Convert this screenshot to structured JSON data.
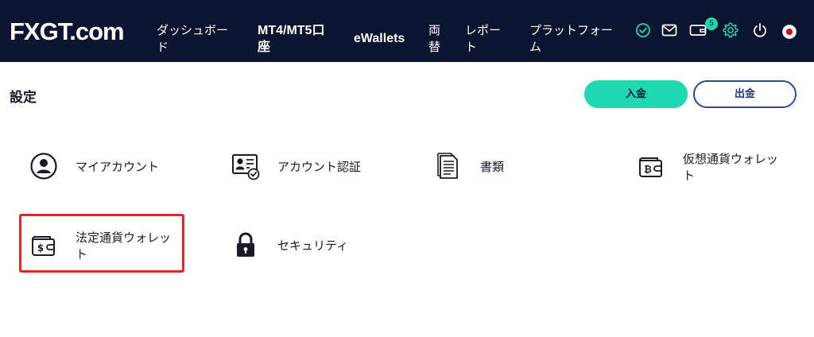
{
  "brand": {
    "logo_text": "FXGT.com"
  },
  "nav": {
    "dashboard": "ダッシュボード",
    "accounts": "MT4/MT5口座",
    "ewallets": "eWallets",
    "exchange": "両替",
    "reports": "レポート",
    "platforms": "プラットフォーム"
  },
  "top_icons": [
    "verified-check-icon",
    "mail-icon",
    "wallet-notifications-icon",
    "gear-icon",
    "power-icon",
    "language-flag-icon"
  ],
  "notifications": {
    "count": "5"
  },
  "page": {
    "title": "設定"
  },
  "actions": {
    "deposit_label": "入金",
    "withdraw_label": "出金"
  },
  "menu": {
    "my_account": "マイアカウント",
    "verification": "アカウント認証",
    "documents": "書類",
    "crypto_wallet": "仮想通貨ウォレット",
    "fiat_wallet": "法定通貨ウォレット",
    "security": "セキュリティ"
  },
  "colors": {
    "nav_bg": "#0b1530",
    "accent": "#1fd7b2",
    "highlight": "#e3261f",
    "outline_button": "#2a4a9a"
  }
}
